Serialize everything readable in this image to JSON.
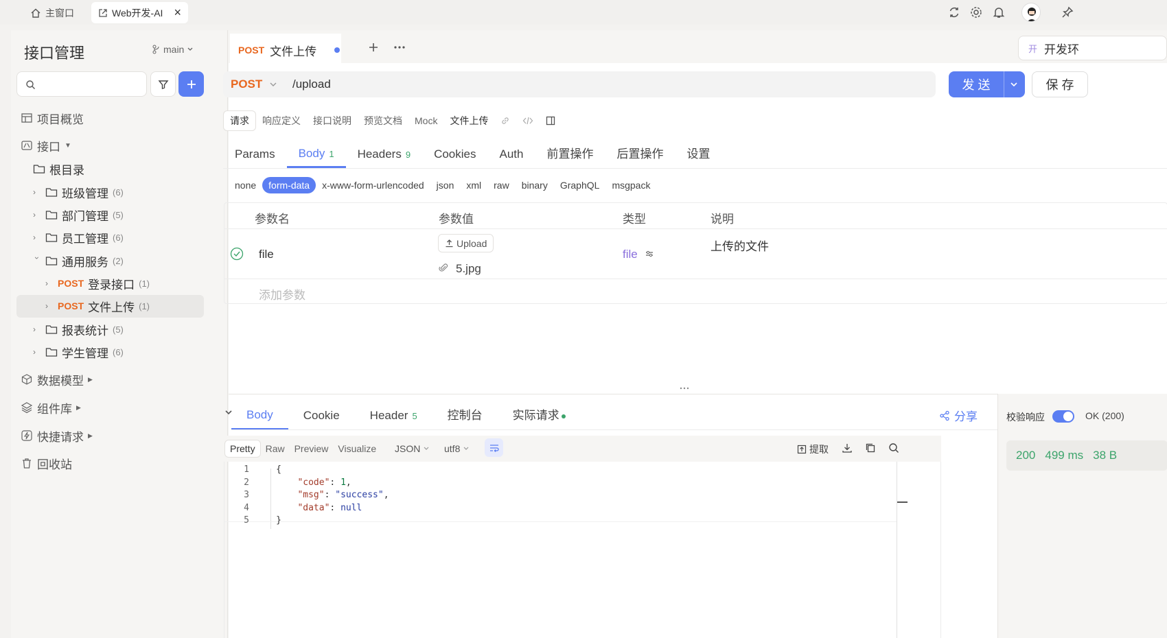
{
  "titlebar": {
    "home_label": "主窗口",
    "active_tab_label": "Web开发-AI",
    "close_glyph": "×"
  },
  "sidebar": {
    "title": "接口管理",
    "branch": "main",
    "search_placeholder": "",
    "nav": {
      "overview": "项目概览",
      "api": "接口",
      "data_model": "数据模型",
      "components": "组件库",
      "quick_request": "快捷请求",
      "recycle": "回收站"
    },
    "tree": {
      "root": "根目录",
      "folders": [
        {
          "label": "班级管理",
          "count": "(6)"
        },
        {
          "label": "部门管理",
          "count": "(5)"
        },
        {
          "label": "员工管理",
          "count": "(6)"
        },
        {
          "label": "通用服务",
          "count": "(2)"
        },
        {
          "label": "报表统计",
          "count": "(5)"
        },
        {
          "label": "学生管理",
          "count": "(6)"
        }
      ],
      "endpoints": [
        {
          "method": "POST",
          "label": "登录接口",
          "count": "(1)"
        },
        {
          "method": "POST",
          "label": "文件上传",
          "count": "(1)"
        }
      ]
    }
  },
  "doc_tab": {
    "method": "POST",
    "title": "文件上传",
    "env_label": "开发环"
  },
  "request": {
    "method": "POST",
    "url": "/upload",
    "send_label": "发 送",
    "save_label": "保 存",
    "subnav": [
      "请求",
      "响应定义",
      "接口说明",
      "预览文档",
      "Mock",
      "文件上传"
    ],
    "tabs": [
      {
        "label": "Params",
        "badge": ""
      },
      {
        "label": "Body",
        "badge": "1"
      },
      {
        "label": "Headers",
        "badge": "9"
      },
      {
        "label": "Cookies",
        "badge": ""
      },
      {
        "label": "Auth",
        "badge": ""
      },
      {
        "label": "前置操作",
        "badge": ""
      },
      {
        "label": "后置操作",
        "badge": ""
      },
      {
        "label": "设置",
        "badge": ""
      }
    ],
    "body_types": [
      "none",
      "form-data",
      "x-www-form-urlencoded",
      "json",
      "xml",
      "raw",
      "binary",
      "GraphQL",
      "msgpack"
    ],
    "table": {
      "headers": [
        "参数名",
        "参数值",
        "类型",
        "说明"
      ],
      "row": {
        "name": "file",
        "upload_label": "Upload",
        "file_name": "5.jpg",
        "type": "file",
        "description": "上传的文件"
      },
      "add_placeholder": "添加参数"
    }
  },
  "response": {
    "tabs": [
      {
        "label": "Body",
        "badge": ""
      },
      {
        "label": "Cookie",
        "badge": ""
      },
      {
        "label": "Header",
        "badge": "5"
      },
      {
        "label": "控制台",
        "badge": ""
      },
      {
        "label": "实际请求",
        "badge": ""
      }
    ],
    "share_label": "分享",
    "formats": [
      "Pretty",
      "Raw",
      "Preview",
      "Visualize"
    ],
    "lang_select": "JSON",
    "encoding_select": "utf8",
    "extract_label": "提取",
    "code_lines": [
      {
        "n": "1",
        "text": "{"
      },
      {
        "n": "2",
        "key": "\"code\"",
        "val": "1",
        "val_type": "number",
        "trail": ","
      },
      {
        "n": "3",
        "key": "\"msg\"",
        "val": "\"success\"",
        "val_type": "string",
        "trail": ","
      },
      {
        "n": "4",
        "key": "\"data\"",
        "val": "null",
        "val_type": "string",
        "trail": ""
      },
      {
        "n": "5",
        "text": "}"
      }
    ]
  },
  "side_panel": {
    "validate_label": "校验响应",
    "validate_on": true,
    "status_text": "OK (200)",
    "status_code": "200",
    "time": "499 ms",
    "size": "38 B"
  },
  "colors": {
    "accent": "#5b7ef2",
    "post": "#e8671f",
    "success": "#3ca46b"
  }
}
